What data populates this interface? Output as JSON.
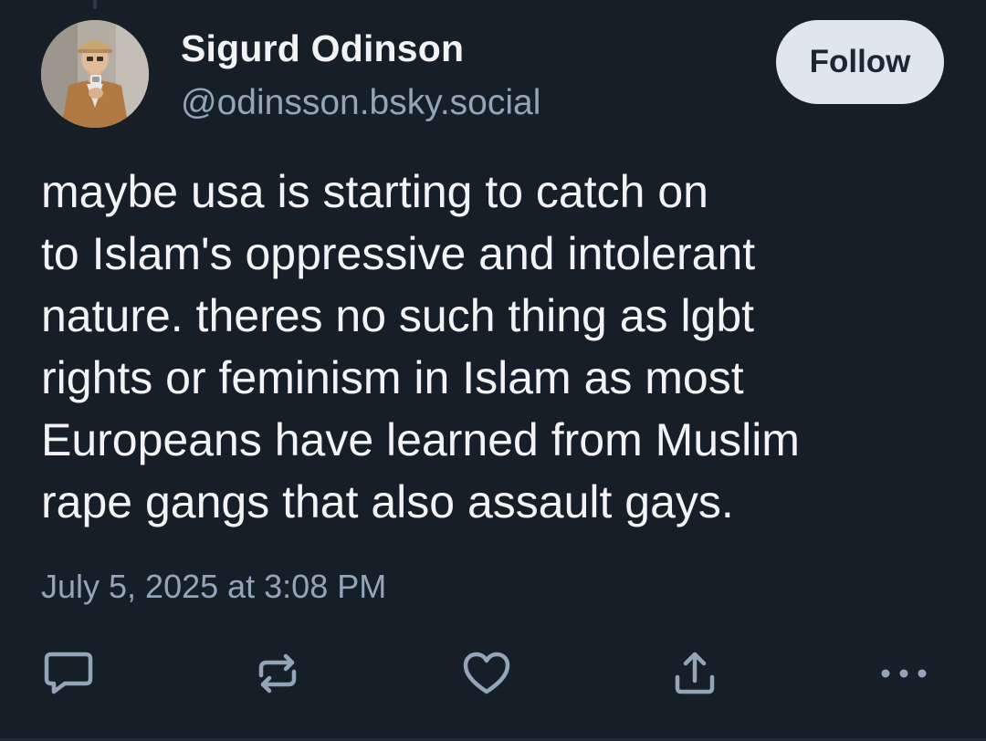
{
  "post": {
    "author": {
      "display_name": "Sigurd Odinson",
      "handle": "@odinsson.bsky.social"
    },
    "follow_label": "Follow",
    "text_lines": [
      "maybe usa is starting to catch on",
      "to Islam's oppressive and intolerant",
      "nature. theres no such thing as lgbt",
      "rights or feminism in Islam as most",
      "Europeans have learned from Muslim",
      "rape gangs that also assault gays."
    ],
    "timestamp": "July 5, 2025 at 3:08 PM",
    "actions": [
      {
        "name": "reply",
        "icon": "speech-bubble-icon"
      },
      {
        "name": "repost",
        "icon": "repost-arrows-icon"
      },
      {
        "name": "like",
        "icon": "heart-icon"
      },
      {
        "name": "share",
        "icon": "share-upload-icon"
      },
      {
        "name": "more",
        "icon": "ellipsis-icon"
      }
    ]
  },
  "colors": {
    "background": "#161e27",
    "text_primary": "#f1f3f5",
    "text_secondary": "#93a5b7",
    "follow_button_bg": "#dfe6ee",
    "follow_button_text": "#1c2734",
    "icon": "#93a5b7"
  }
}
